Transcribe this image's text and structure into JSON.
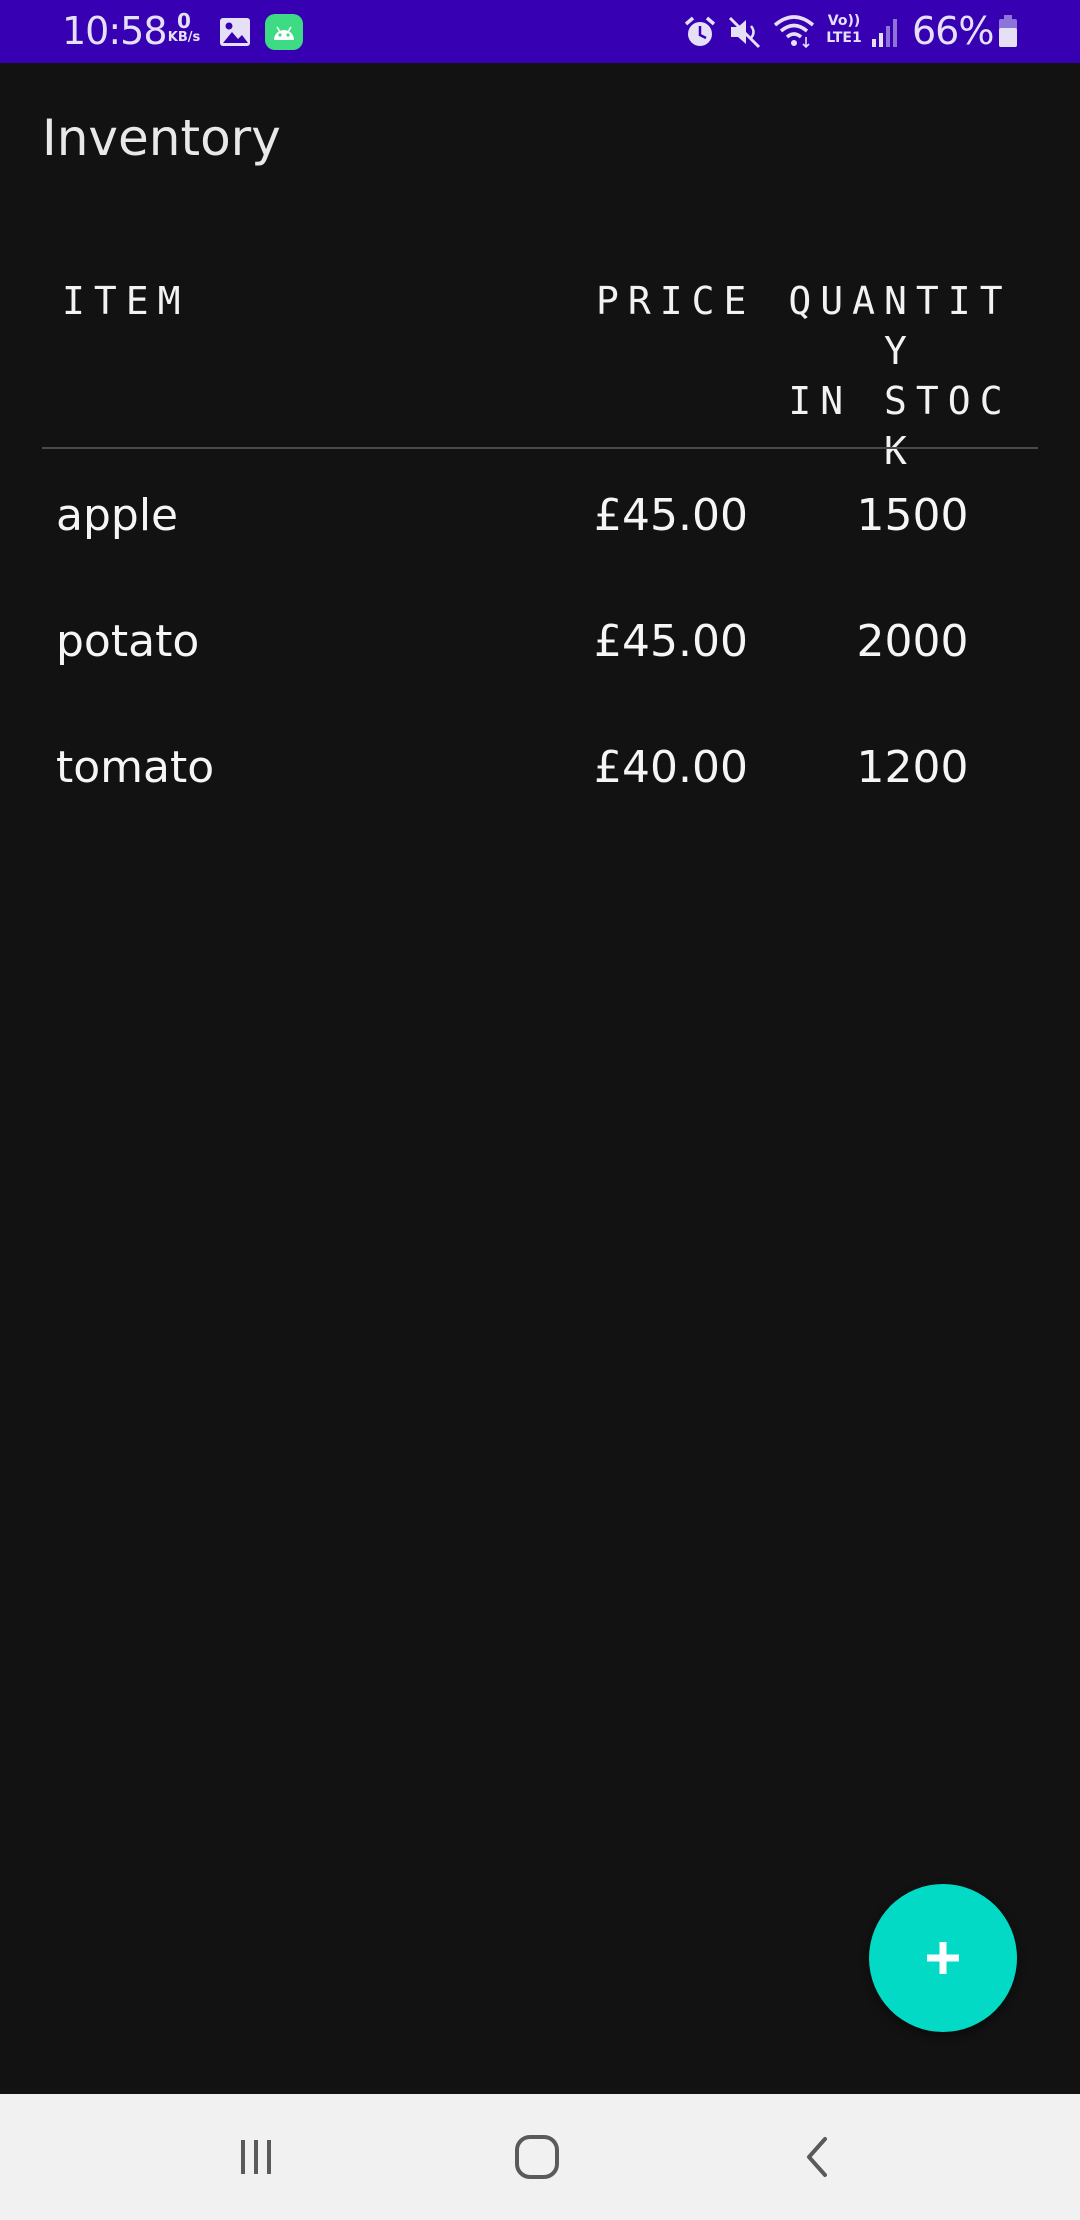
{
  "status_bar": {
    "time": "10:58",
    "net_speed_value": "0",
    "net_speed_unit": "KB/s",
    "lte_label": "Vo)) LTE1",
    "battery": "66%",
    "bg_color": "#3700b3",
    "icons": [
      "gallery-icon",
      "android-icon",
      "alarm-icon",
      "mute-icon",
      "wifi-icon",
      "signal-icon",
      "battery-icon"
    ]
  },
  "app": {
    "title": "Inventory"
  },
  "table": {
    "headers": {
      "item": "ITEM",
      "price": "PRICE",
      "quantity": "QUANTITY\nIN STOCK"
    },
    "rows": [
      {
        "name": "apple",
        "price": "£45.00",
        "quantity": "1500"
      },
      {
        "name": "potato",
        "price": "£45.00",
        "quantity": "2000"
      },
      {
        "name": "tomato",
        "price": "£40.00",
        "quantity": "1200"
      }
    ]
  },
  "fab": {
    "icon": "add-icon",
    "color": "#03dac5"
  },
  "nav_bar": {
    "buttons": [
      "recents-icon",
      "home-icon",
      "back-icon"
    ]
  }
}
